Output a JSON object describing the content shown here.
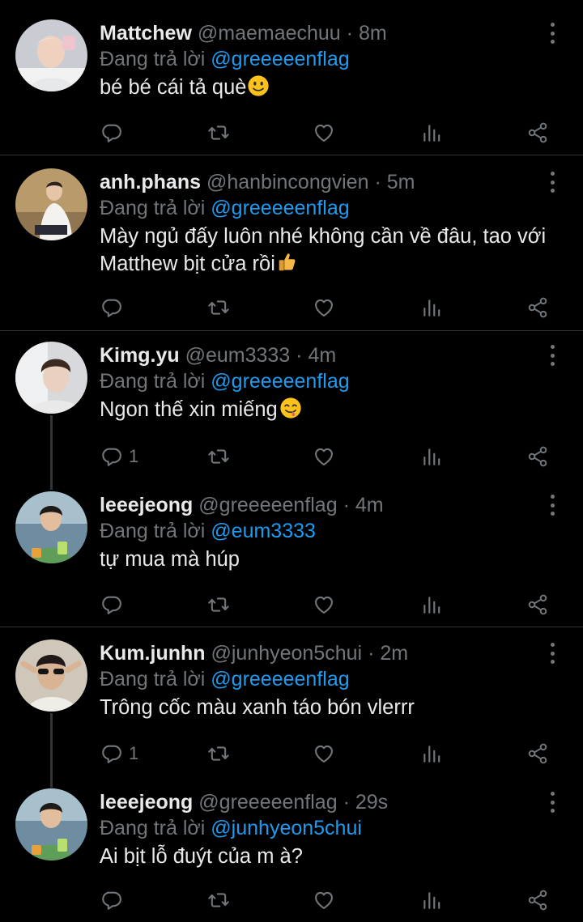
{
  "tweets": [
    {
      "name": "Mattchew",
      "handle": "@maemaechuu",
      "dot": "·",
      "time": "8m",
      "reply_prefix": "Đang trả lời",
      "reply_to": "@greeeeenflag",
      "text": "bé bé cái tả què",
      "emoji": "slightly-smiling-face-icon",
      "reply_count": ""
    },
    {
      "name": "anh.phans",
      "handle": "@hanbincongvien",
      "dot": "·",
      "time": "5m",
      "reply_prefix": "Đang trả lời",
      "reply_to": "@greeeeenflag",
      "text": "Mày ngủ đấy luôn nhé không cần về đâu, tao với Matthew bịt cửa rồi",
      "emoji": "thumbs-up-icon",
      "reply_count": ""
    },
    {
      "name": "Kimg.yu",
      "handle": "@eum3333",
      "dot": "·",
      "time": "4m",
      "reply_prefix": "Đang trả lời",
      "reply_to": "@greeeeenflag",
      "text": "Ngon thế xin miếng",
      "emoji": "face-savoring-food-icon",
      "reply_count": "1"
    },
    {
      "name": "leeejeong",
      "handle": "@greeeeenflag",
      "dot": "·",
      "time": "4m",
      "reply_prefix": "Đang trả lời",
      "reply_to": "@eum3333",
      "text": "tự mua mà húp",
      "emoji": "",
      "reply_count": ""
    },
    {
      "name": "Kum.junhn",
      "handle": "@junhyeon5chui",
      "dot": "·",
      "time": "2m",
      "reply_prefix": "Đang trả lời",
      "reply_to": "@greeeeenflag",
      "text": "Trông cốc màu xanh táo bón vlerrr",
      "emoji": "",
      "reply_count": "1"
    },
    {
      "name": "leeejeong",
      "handle": "@greeeeenflag",
      "dot": "·",
      "time": "29s",
      "reply_prefix": "Đang trả lời",
      "reply_to": "@junhyeon5chui",
      "text": "Ai bịt lỗ đuýt của m à?",
      "emoji": "",
      "reply_count": ""
    }
  ],
  "icons": {
    "reply": "reply-icon",
    "retweet": "retweet-icon",
    "like": "heart-icon",
    "views": "views-icon",
    "share": "share-icon",
    "more": "more-options-icon"
  },
  "colors": {
    "background": "#000000",
    "text": "#e7e9ea",
    "secondary": "#71767b",
    "link": "#1d9bf0",
    "divider": "#2f3336"
  }
}
